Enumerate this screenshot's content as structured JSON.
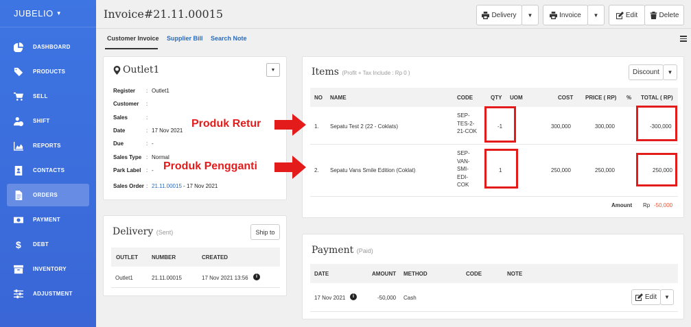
{
  "brand": "JUBELIO",
  "nav": [
    {
      "label": "DASHBOARD",
      "icon": "pie-chart-icon"
    },
    {
      "label": "PRODUCTS",
      "icon": "tag-icon"
    },
    {
      "label": "SELL",
      "icon": "cart-icon"
    },
    {
      "label": "SHIFT",
      "icon": "user-clock-icon"
    },
    {
      "label": "REPORTS",
      "icon": "area-chart-icon"
    },
    {
      "label": "CONTACTS",
      "icon": "contact-book-icon"
    },
    {
      "label": "ORDERS",
      "icon": "file-icon",
      "active": true
    },
    {
      "label": "PAYMENT",
      "icon": "money-icon"
    },
    {
      "label": "DEBT",
      "icon": "dollar-icon"
    },
    {
      "label": "INVENTORY",
      "icon": "archive-icon"
    },
    {
      "label": "ADJUSTMENT",
      "icon": "sliders-icon"
    }
  ],
  "header": {
    "title": "Invoice#21.11.00015",
    "delivery_label": "Delivery",
    "invoice_label": "Invoice",
    "edit_label": "Edit",
    "delete_label": "Delete"
  },
  "tabs": [
    "Customer Invoice",
    "Supplier Bill",
    "Search Note"
  ],
  "outlet": {
    "title": "Outlet1",
    "fields": [
      {
        "key": "Register",
        "value": "Outlet1"
      },
      {
        "key": "Customer",
        "value": ""
      },
      {
        "key": "Sales",
        "value": ""
      },
      {
        "key": "Date",
        "value": "17 Nov 2021"
      },
      {
        "key": "Due",
        "value": "-"
      },
      {
        "key": "Sales Type",
        "value": "Normal"
      },
      {
        "key": "Park Label",
        "value": "-"
      }
    ],
    "sales_order_key": "Sales Order",
    "sales_order_link": "21.11.00015",
    "sales_order_date": " - 17 Nov 2021"
  },
  "delivery": {
    "title": "Delivery",
    "status": "(Sent)",
    "ship_label": "Ship to",
    "headers": [
      "OUTLET",
      "NUMBER",
      "CREATED"
    ],
    "row": {
      "outlet": "Outlet1",
      "number": "21.11.00015",
      "created": "17 Nov 2021 13:56"
    }
  },
  "items": {
    "title": "Items",
    "subtitle": "(Profit + Tax Include : Rp 0 )",
    "discount_label": "Discount",
    "headers": [
      "NO",
      "NAME",
      "CODE",
      "QTY",
      "UOM",
      "COST",
      "PRICE ( RP)",
      "%",
      "TOTAL ( RP)"
    ],
    "rows": [
      {
        "no": "1.",
        "name": "Sepatu Test 2 (22 - Coklats)",
        "code": "SEP-\nTES-2-\n21-COK",
        "qty": "-1",
        "uom": "",
        "cost": "300,000",
        "price": "300,000",
        "pct": "",
        "total": "-300,000"
      },
      {
        "no": "2.",
        "name": "Sepatu Vans Smile Edition (Coklat)",
        "code": "SEP-\nVAN-\nSMI-\nEDI-\nCOK",
        "qty": "1",
        "uom": "",
        "cost": "250,000",
        "price": "250,000",
        "pct": "",
        "total": "250,000"
      }
    ],
    "amount_label": "Amount",
    "amount_currency": "Rp",
    "amount_value": "-50,000"
  },
  "annotations": {
    "retur": "Produk Retur",
    "pengganti": "Produk Pengganti"
  },
  "payment": {
    "title": "Payment",
    "status": "(Paid)",
    "headers": [
      "DATE",
      "AMOUNT",
      "METHOD",
      "CODE",
      "NOTE"
    ],
    "row": {
      "date": "17 Nov 2021",
      "amount": "-50,000",
      "method": "Cash",
      "code": "",
      "note": ""
    },
    "edit_label": "Edit"
  },
  "colors": {
    "accent": "#3a6fdc",
    "link": "#2a6ab8",
    "annotation": "#e31b1b",
    "negative": "#e05a3a"
  }
}
